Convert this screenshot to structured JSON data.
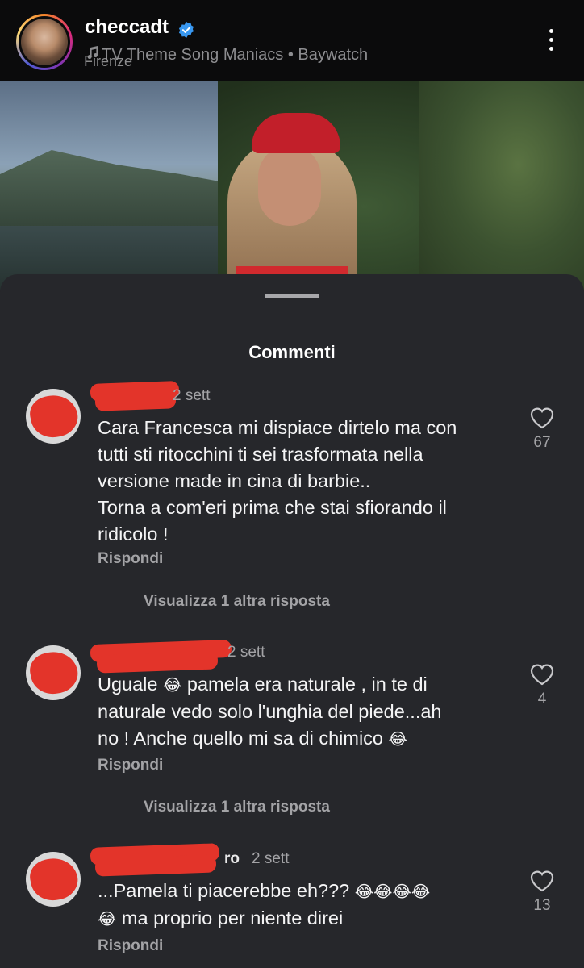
{
  "header": {
    "username": "checcadt",
    "music": "TV Theme Song Maniacs • Baywatch",
    "location": "Firenze"
  },
  "sheet": {
    "title": "Commenti"
  },
  "comments": [
    {
      "time": "2 sett",
      "lines": [
        "Cara Francesca mi dispiace dirtelo ma con",
        "tutti sti ritocchini ti sei trasformata nella",
        "versione made in cina di barbie..",
        "Torna a com'eri prima che stai sfiorando il",
        "ridicolo !"
      ],
      "reply_label": "Rispondi",
      "more_replies": "Visualizza 1 altra risposta",
      "likes": "67"
    },
    {
      "time": "2 sett",
      "line1a": "Uguale",
      "line1b": "pamela era naturale , in te di",
      "line2": "naturale vedo solo l'unghia del piede...ah",
      "line3": "no ! Anche quello mi sa di chimico",
      "reply_label": "Rispondi",
      "more_replies": "Visualizza 1 altra risposta",
      "likes": "4"
    },
    {
      "name_tail": "ro",
      "time": "2 sett",
      "line1": "...Pamela ti piacerebbe eh???",
      "line2": "ma proprio per niente direi",
      "reply_label": "Rispondi",
      "likes": "13"
    }
  ],
  "emoji": {
    "laugh": "😂"
  },
  "colors": {
    "background": "#26272b",
    "header": "#0b0b0c",
    "verified": "#3897f0",
    "redaction": "#e3342a",
    "muted_text": "#a3a3a6"
  }
}
